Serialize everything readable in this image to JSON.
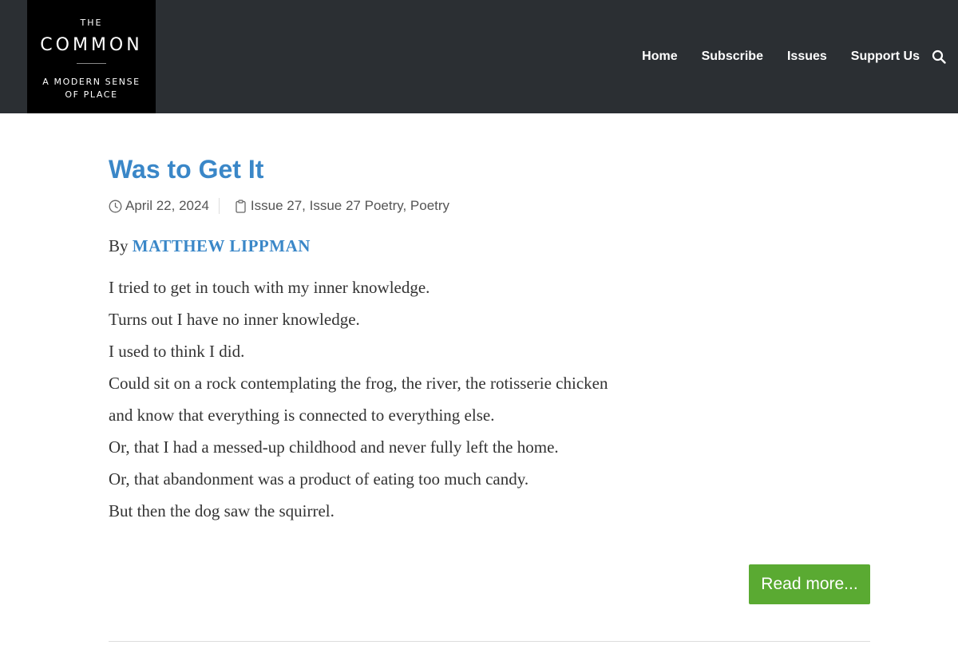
{
  "logo": {
    "top": "THE",
    "main": "COMMON",
    "tagline_line1": "A MODERN SENSE",
    "tagline_line2": "OF PLACE"
  },
  "nav": {
    "items": [
      {
        "label": "Home"
      },
      {
        "label": "Subscribe"
      },
      {
        "label": "Issues"
      },
      {
        "label": "Support Us"
      }
    ],
    "search_icon": "search-icon"
  },
  "post": {
    "title": "Was to Get It",
    "date": "April 22, 2024",
    "categories": "Issue 27, Issue 27 Poetry, Poetry",
    "by_prefix": "By",
    "author": "MATTHEW LIPPMAN",
    "lines": [
      "I tried to get in touch with my inner knowledge.",
      "Turns out I have no inner knowledge.",
      "I used to think I did.",
      "Could sit on a rock contemplating the frog, the river, the rotisserie chicken",
      "and know that everything is connected to everything else.",
      "Or, that I had a messed-up childhood and never fully left the home.",
      "Or, that abandonment was a product of eating too much candy.",
      "But then the dog saw the squirrel."
    ],
    "read_more": "Read more..."
  },
  "colors": {
    "header_bg": "#2b2f33",
    "accent_blue": "#3a87c8",
    "button_green": "#5aaa32"
  }
}
